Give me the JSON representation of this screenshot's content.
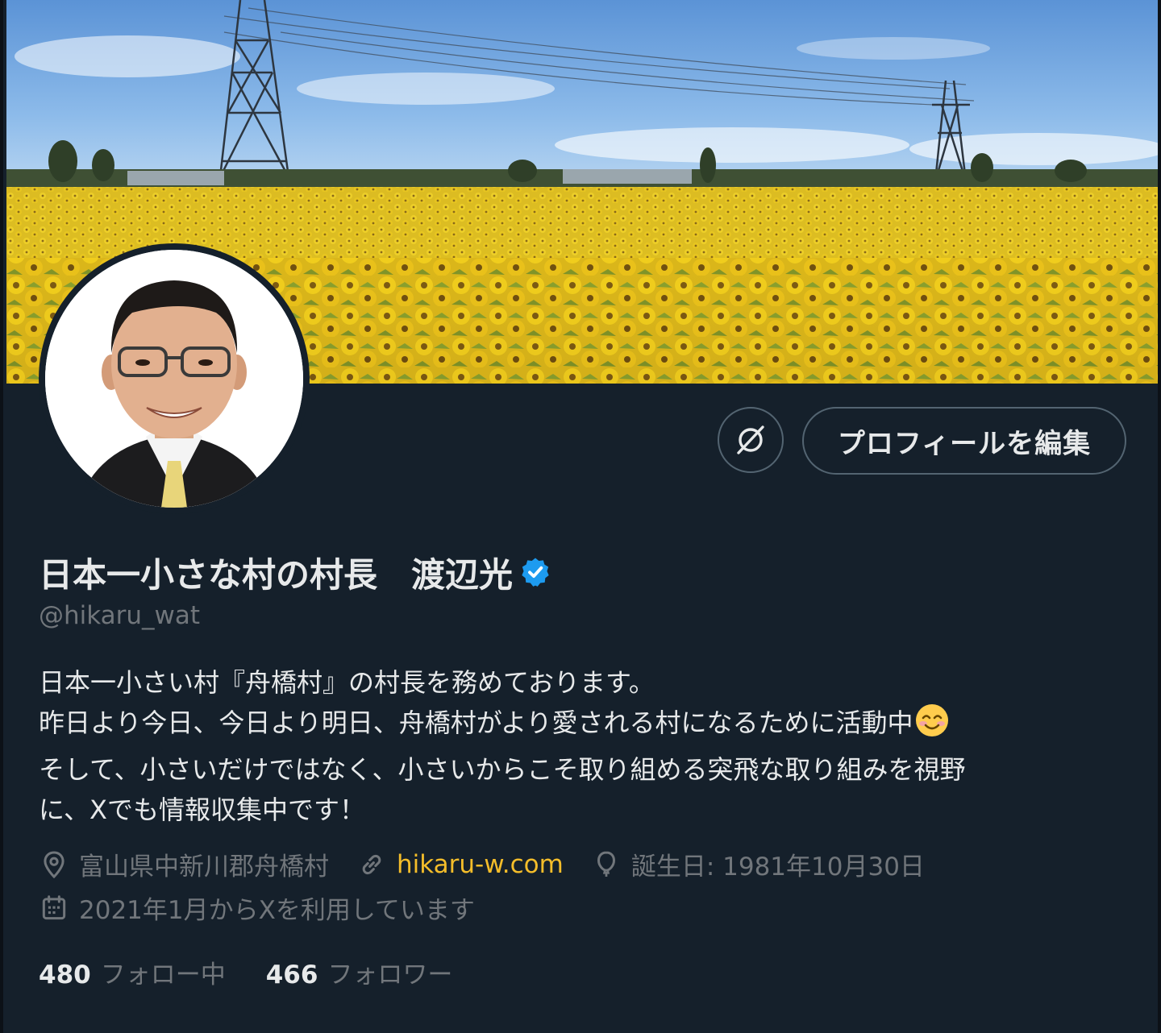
{
  "profile": {
    "display_name": "日本一小さな村の村長　渡辺光",
    "handle": "@hikaru_wat",
    "verified": true,
    "bio_lines": [
      "日本一小さい村『舟橋村』の村長を務めております。",
      "昨日より今日、今日より明日、舟橋村がより愛される村になるために活動中",
      "そして、小さいだけではなく、小さいからこそ取り組める突飛な取り組みを視野",
      "に、Xでも情報収集中です！"
    ],
    "bio_emoji": "smiling-face-with-smiling-eyes",
    "location": "富山県中新川郡舟橋村",
    "website": "hikaru-w.com",
    "birthday": "誕生日: 1981年10月30日",
    "joined": "2021年1月からXを利用しています",
    "following_count": "480",
    "following_label": "フォロー中",
    "followers_count": "466",
    "followers_label": "フォロワー"
  },
  "actions": {
    "edit_profile_label": "プロフィールを編集",
    "circle_button_icon": "grok-ask-icon"
  },
  "colors": {
    "background": "#15202b",
    "text": "#e7e9ea",
    "secondary_text": "#71767b",
    "link": "#f4bd2a",
    "verified": "#1d9bf0",
    "button_border": "#536471"
  },
  "banner": {
    "subject": "sunflower field with power pylons"
  },
  "icons": {
    "location": "location-pin-icon",
    "website": "link-icon",
    "birthday": "balloon-icon",
    "joined": "calendar-icon"
  }
}
